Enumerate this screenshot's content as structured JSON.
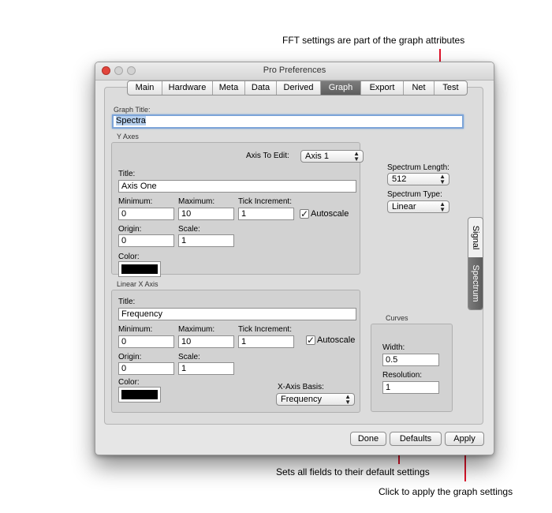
{
  "annotations": {
    "fft": "FFT settings are part of the graph attributes",
    "defaults": "Sets all fields to their default settings",
    "apply": "Click to apply the graph settings"
  },
  "window": {
    "title": "Pro Preferences"
  },
  "tabs": [
    "Main",
    "Hardware",
    "Meta",
    "Data",
    "Derived",
    "Graph",
    "Export",
    "Net",
    "Test"
  ],
  "active_tab": "Graph",
  "graph_title": {
    "label": "Graph Title:",
    "value": "Spectra"
  },
  "y_axes": {
    "group_label": "Y Axes",
    "axis_to_edit_label": "Axis To Edit:",
    "axis_to_edit_value": "Axis 1",
    "title_label": "Title:",
    "title_value": "Axis One",
    "minimum_label": "Minimum:",
    "minimum_value": "0",
    "maximum_label": "Maximum:",
    "maximum_value": "10",
    "tick_label": "Tick Increment:",
    "tick_value": "1",
    "autoscale_label": "Autoscale",
    "autoscale_checked": true,
    "origin_label": "Origin:",
    "origin_value": "0",
    "scale_label": "Scale:",
    "scale_value": "1",
    "color_label": "Color:",
    "color": "#000000"
  },
  "x_axis": {
    "group_label": "Linear X Axis",
    "title_label": "Title:",
    "title_value": "Frequency",
    "minimum_label": "Minimum:",
    "minimum_value": "0",
    "maximum_label": "Maximum:",
    "maximum_value": "10",
    "tick_label": "Tick Increment:",
    "tick_value": "1",
    "autoscale_label": "Autoscale",
    "autoscale_checked": true,
    "origin_label": "Origin:",
    "origin_value": "0",
    "scale_label": "Scale:",
    "scale_value": "1",
    "color_label": "Color:",
    "color": "#000000",
    "basis_label": "X-Axis Basis:",
    "basis_value": "Frequency"
  },
  "spectrum": {
    "length_label": "Spectrum Length:",
    "length_value": "512",
    "type_label": "Spectrum Type:",
    "type_value": "Linear"
  },
  "side_tabs": [
    "Signal",
    "Spectrum"
  ],
  "active_side_tab": "Spectrum",
  "curves": {
    "group_label": "Curves",
    "width_label": "Width:",
    "width_value": "0.5",
    "resolution_label": "Resolution:",
    "resolution_value": "1"
  },
  "buttons": {
    "done": "Done",
    "defaults": "Defaults",
    "apply": "Apply"
  },
  "colors": {
    "annotation_line": "#e0142b",
    "active_tab": "#6b6b6b",
    "focus_ring": "#7ca4d8"
  }
}
